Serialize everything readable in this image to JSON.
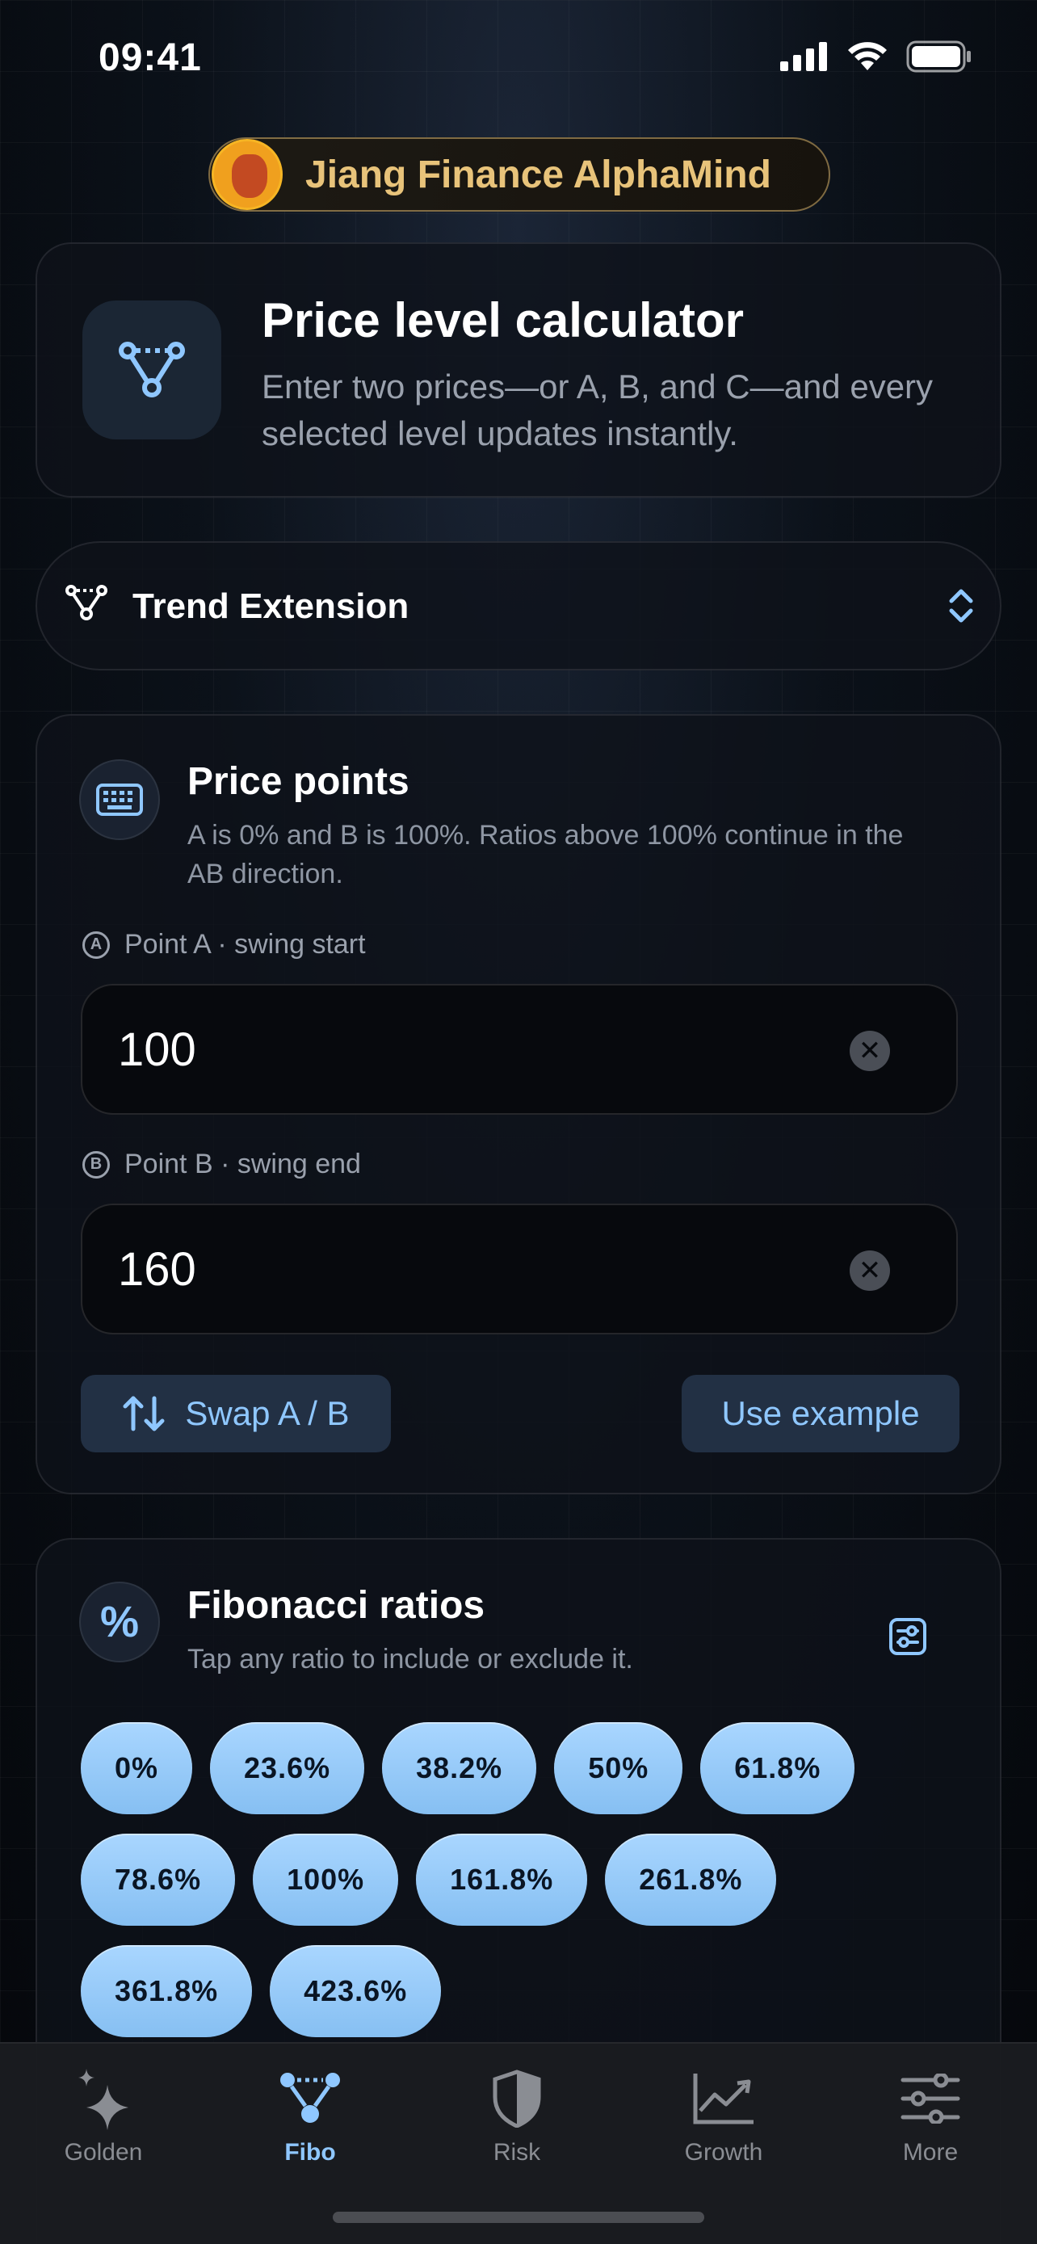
{
  "status": {
    "time": "09:41"
  },
  "brand": {
    "title": "Jiang Finance AlphaMind"
  },
  "header": {
    "title": "Price level calculator",
    "subtitle": "Enter two prices—or A, B, and C—and every selected level updates instantly."
  },
  "mode": {
    "label": "Trend Extension"
  },
  "points": {
    "title": "Price points",
    "subtitle": "A is 0% and B is 100%. Ratios above 100% continue in the AB direction.",
    "a": {
      "letter": "A",
      "label": "Point A · swing start",
      "value": "100"
    },
    "b": {
      "letter": "B",
      "label": "Point B · swing end",
      "value": "160"
    },
    "swap_label": "Swap A / B",
    "example_label": "Use example",
    "clear_glyph": "✕"
  },
  "ratios": {
    "title": "Fibonacci ratios",
    "subtitle": "Tap any ratio to include or exclude it.",
    "icon_glyph": "%",
    "rows": [
      [
        "0%",
        "23.6%",
        "38.2%",
        "50%",
        "61.8%"
      ],
      [
        "78.6%",
        "100%",
        "161.8%",
        "261.8%"
      ],
      [
        "361.8%",
        "423.6%"
      ]
    ]
  },
  "tabs": [
    {
      "label": "Golden",
      "icon": "sparkles-icon",
      "active": false
    },
    {
      "label": "Fibo",
      "icon": "fibo-nodes-icon",
      "active": true
    },
    {
      "label": "Risk",
      "icon": "shield-icon",
      "active": false
    },
    {
      "label": "Growth",
      "icon": "chart-line-icon",
      "active": false
    },
    {
      "label": "More",
      "icon": "sliders-icon",
      "active": false
    }
  ],
  "colors": {
    "accent": "#8fc7ff",
    "chip": "#9dcefc",
    "brand_gold": "#e8c37a",
    "background": "#0b1119"
  }
}
